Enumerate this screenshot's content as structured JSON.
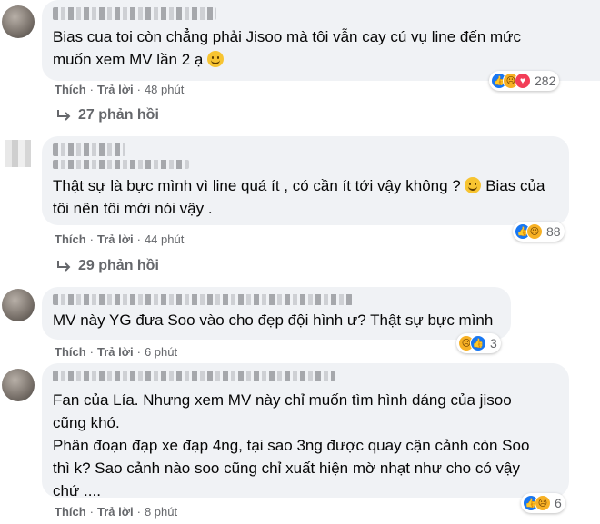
{
  "comments": [
    {
      "text_line1": "Bias cua toi còn chẳng phải Jisoo mà tôi vẫn cay cú vụ line đến mức",
      "text_line2": "muốn xem MV lần 2 ạ",
      "like_label": "Thích",
      "reply_label": "Trả lời",
      "time": "48 phút",
      "reaction_count": "282",
      "reactions": [
        "like-icon",
        "sad-icon",
        "love-icon"
      ],
      "replies_label": "27 phản hồi"
    },
    {
      "text_line1": "Thật sự là bực mình vì line quá ít , có cần ít tới vậy không ?",
      "text_line1b": "Bias của",
      "text_line2": "tôi nên tôi mới nói vậy .",
      "like_label": "Thích",
      "reply_label": "Trả lời",
      "time": "44 phút",
      "reaction_count": "88",
      "reactions": [
        "like-icon",
        "sad-icon"
      ],
      "replies_label": "29 phản hồi"
    },
    {
      "text_line1": "MV này YG đưa Soo vào cho đẹp đội hình ư? Thật sự bực mình",
      "like_label": "Thích",
      "reply_label": "Trả lời",
      "time": "6 phút",
      "reaction_count": "3",
      "reactions": [
        "sad-icon",
        "like-icon"
      ]
    },
    {
      "text_line1": "Fan của Lía. Nhưng xem MV này chỉ muốn tìm hình dáng của jisoo",
      "text_line2": "cũng khó.",
      "text_line3": "Phân đoạn đạp xe đạp 4ng, tại sao 3ng được quay cận cảnh còn Soo",
      "text_line4": "thì k? Sao cảnh nào soo cũng chỉ xuất hiện mờ nhạt như cho có vậy",
      "text_line5": "chứ ....",
      "like_label": "Thích",
      "reply_label": "Trả lời",
      "time": "8 phút",
      "reaction_count": "6",
      "reactions": [
        "like-icon",
        "sad-icon"
      ]
    }
  ],
  "colors": {
    "bubble": "#f0f2f5",
    "meta": "#65676b",
    "like": "#1877f2",
    "sad": "#f7b125",
    "love": "#f33e58"
  }
}
